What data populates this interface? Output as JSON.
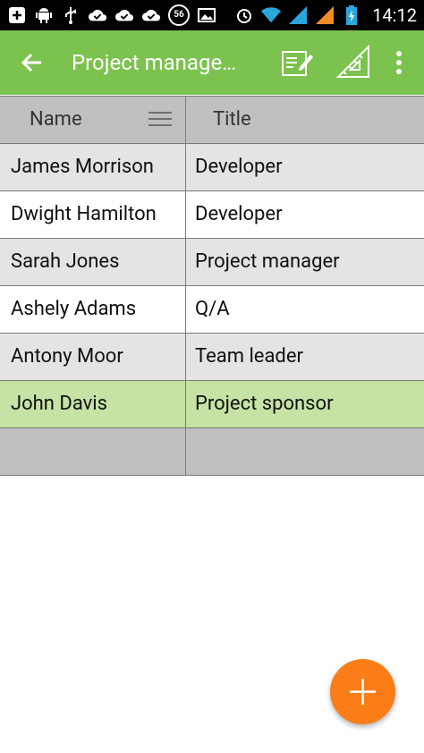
{
  "status_bar": {
    "time": "14:12",
    "badge": "56",
    "left_icons": [
      "add-icon",
      "android-icon",
      "usb-icon",
      "cloud-check-icon",
      "cloud-check-icon",
      "cloud-check-icon",
      "badge-56",
      "image-icon"
    ],
    "right_icons": [
      "alarm-icon",
      "wifi-icon",
      "signal-icon",
      "signal-icon",
      "battery-icon"
    ]
  },
  "app_bar": {
    "title": "Project manage…",
    "color": "#7cc24e",
    "actions": [
      "edit-note-icon",
      "ruler-icon",
      "more-vert-icon"
    ]
  },
  "table": {
    "columns": [
      "Name",
      "Title"
    ],
    "rows": [
      {
        "name": "James Morrison",
        "title": "Developer",
        "style": "gray"
      },
      {
        "name": "Dwight Hamilton",
        "title": "Developer",
        "style": "white"
      },
      {
        "name": "Sarah Jones",
        "title": "Project manager",
        "style": "gray"
      },
      {
        "name": "Ashely Adams",
        "title": "Q/A",
        "style": "white"
      },
      {
        "name": "Antony Moor",
        "title": "Team leader",
        "style": "gray"
      },
      {
        "name": "John Davis",
        "title": "Project sponsor",
        "style": "selected"
      },
      {
        "name": "",
        "title": "",
        "style": "empty"
      }
    ]
  },
  "fab": {
    "icon": "add-icon",
    "color": "#fb7d17"
  }
}
